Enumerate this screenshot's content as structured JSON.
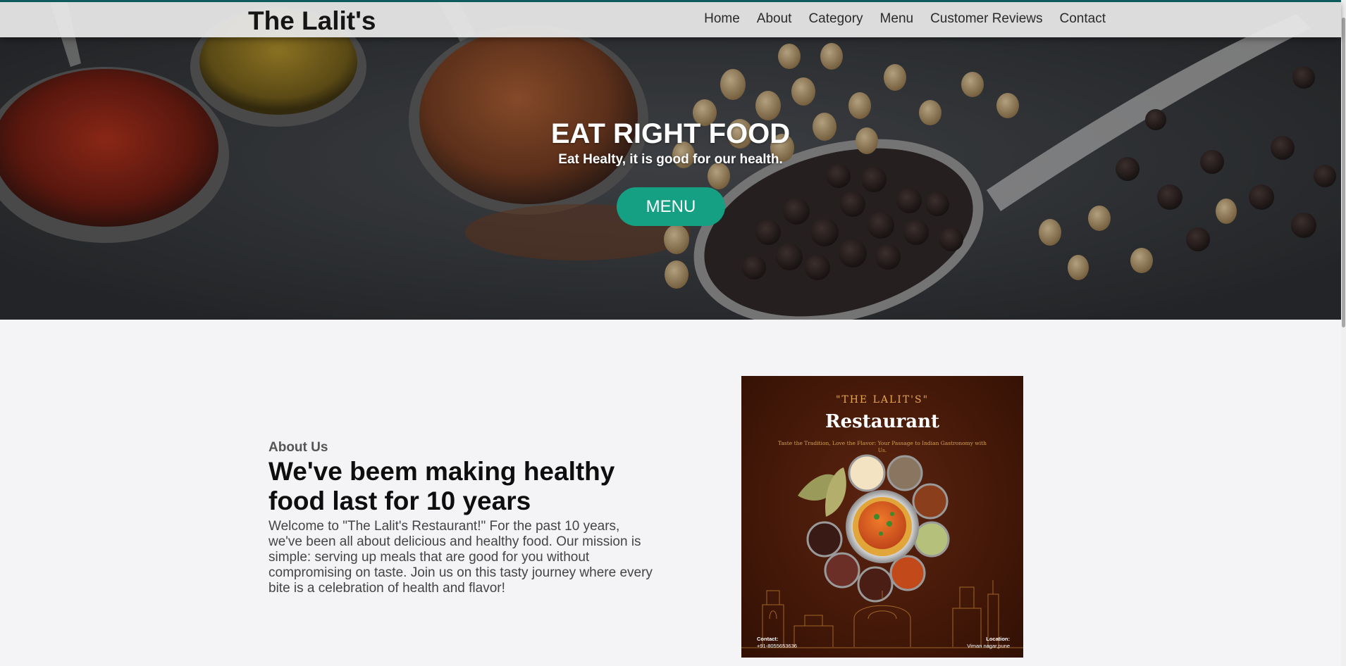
{
  "header": {
    "brand": "The Lalit's",
    "nav": [
      "Home",
      "About",
      "Category",
      "Menu",
      "Customer Reviews",
      "Contact"
    ]
  },
  "hero": {
    "title": "EAT RIGHT FOOD",
    "subtitle": "Eat Healty, it is good for our health.",
    "button_label": "MENU"
  },
  "about": {
    "eyebrow": "About Us",
    "heading": "We've beem making healthy food last for 10 years",
    "body": "Welcome to \"The Lalit's Restaurant!\" For the past 10 years, we've been all about delicious and healthy food. Our mission is simple: serving up meals that are good for you without compromising on taste. Join us on this tasty journey where every bite is a celebration of health and flavor!"
  },
  "poster": {
    "brand": "\"THE LALIT'S\"",
    "title": "Restaurant",
    "tagline": "Taste the Tradition, Love the Flavor: Your Passage to Indian Gastronomy with Us.",
    "contact_label": "Contact:",
    "contact_value": "+91-8055653636",
    "location_label": "Location:",
    "location_value": "Viman nagar,pune"
  },
  "colors": {
    "accent": "#15a083",
    "topline": "#0d5f61",
    "poster_bg": "#3f1607"
  }
}
